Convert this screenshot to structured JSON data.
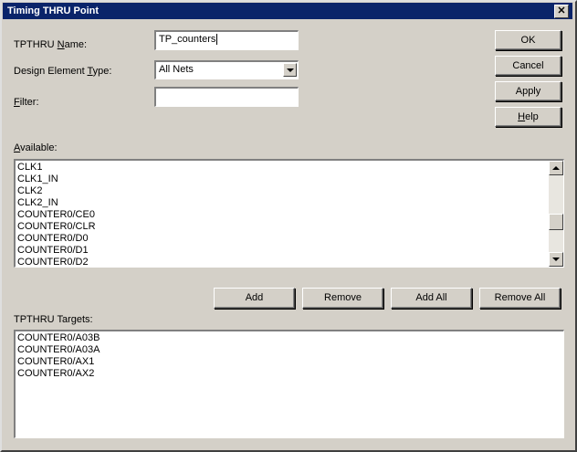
{
  "window": {
    "title": "Timing THRU Point",
    "close_glyph": "✕"
  },
  "form": {
    "name_label_pre": "TPTHRU ",
    "name_label_accel": "N",
    "name_label_post": "ame:",
    "name_value": "TP_counters",
    "type_label_pre": "Design Element ",
    "type_label_accel": "T",
    "type_label_post": "ype:",
    "type_value": "All Nets",
    "filter_label_accel": "F",
    "filter_label_post": "ilter:",
    "filter_value": ""
  },
  "buttons": {
    "ok": "OK",
    "cancel": "Cancel",
    "apply": "Apply",
    "help_accel": "H",
    "help_post": "elp",
    "add": "Add",
    "remove": "Remove",
    "add_all": "Add All",
    "remove_all": "Remove All"
  },
  "available": {
    "label_accel": "A",
    "label_post": "vailable:",
    "items": [
      "CLK1",
      "CLK1_IN",
      "CLK2",
      "CLK2_IN",
      "COUNTER0/CE0",
      "COUNTER0/CLR",
      "COUNTER0/D0",
      "COUNTER0/D1",
      "COUNTER0/D2"
    ]
  },
  "targets": {
    "label": "TPTHRU Targets:",
    "items": [
      "COUNTER0/A03B",
      "COUNTER0/A03A",
      "COUNTER0/AX1",
      "COUNTER0/AX2"
    ]
  },
  "colors": {
    "titlebar": "#0a246a",
    "face": "#d4d0c8"
  }
}
